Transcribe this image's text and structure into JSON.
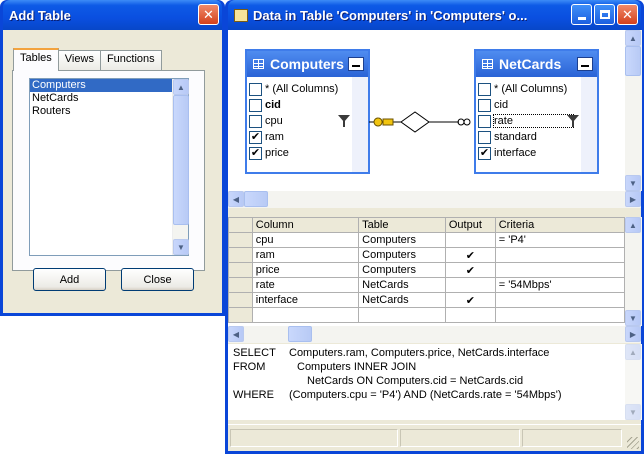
{
  "add_table": {
    "title": "Add Table",
    "tabs": [
      "Tables",
      "Views",
      "Functions"
    ],
    "tables": [
      "Computers",
      "NetCards",
      "Routers"
    ],
    "selected_table": "Computers",
    "add_label": "Add",
    "close_label": "Close"
  },
  "query": {
    "title": "Data in Table 'Computers' in 'Computers' o...",
    "computers": {
      "name": "Computers",
      "columns": [
        {
          "label": "* (All Columns)",
          "checked": false,
          "bold": false,
          "filter": false
        },
        {
          "label": "cid",
          "checked": false,
          "bold": true,
          "filter": false
        },
        {
          "label": "cpu",
          "checked": false,
          "bold": false,
          "filter": true
        },
        {
          "label": "ram",
          "checked": true,
          "bold": false,
          "filter": false
        },
        {
          "label": "price",
          "checked": true,
          "bold": false,
          "filter": false
        }
      ]
    },
    "netcards": {
      "name": "NetCards",
      "columns": [
        {
          "label": "* (All Columns)",
          "checked": false,
          "bold": false,
          "filter": false
        },
        {
          "label": "cid",
          "checked": false,
          "bold": false,
          "filter": false
        },
        {
          "label": "rate",
          "checked": false,
          "bold": false,
          "filter": true
        },
        {
          "label": "standard",
          "checked": false,
          "bold": false,
          "filter": false
        },
        {
          "label": "interface",
          "checked": true,
          "bold": false,
          "filter": false
        }
      ]
    },
    "grid": {
      "headers": [
        "Column",
        "Table",
        "Output",
        "Criteria"
      ],
      "rows": [
        {
          "column": "cpu",
          "table": "Computers",
          "output": false,
          "criteria": "= 'P4'"
        },
        {
          "column": "ram",
          "table": "Computers",
          "output": true,
          "criteria": ""
        },
        {
          "column": "price",
          "table": "Computers",
          "output": true,
          "criteria": ""
        },
        {
          "column": "rate",
          "table": "NetCards",
          "output": false,
          "criteria": "= '54Mbps'"
        },
        {
          "column": "interface",
          "table": "NetCards",
          "output": true,
          "criteria": ""
        }
      ]
    },
    "sql": {
      "select_kw": "SELECT",
      "select_expr": "Computers.ram, Computers.price, NetCards.interface",
      "from_kw": "FROM",
      "from_expr1": "Computers INNER JOIN",
      "from_expr2": "NetCards ON Computers.cid = NetCards.cid",
      "where_kw": "WHERE",
      "where_expr": "(Computers.cpu = 'P4') AND (NetCards.rate = '54Mbps')"
    },
    "check_mark": "✔"
  }
}
